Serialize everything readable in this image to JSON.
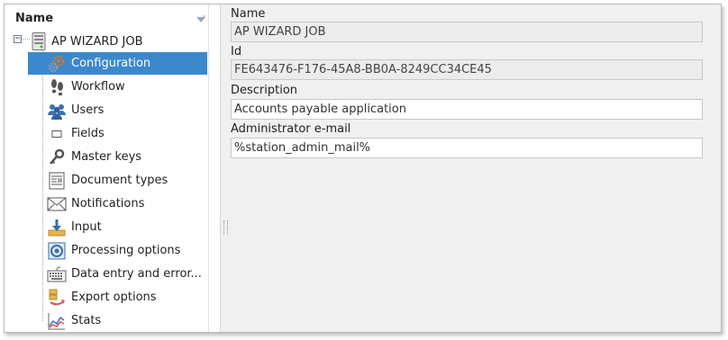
{
  "tree": {
    "header": "Name",
    "root": {
      "label": "AP WIZARD JOB"
    },
    "items": [
      {
        "label": "Configuration",
        "icon": "gears-icon"
      },
      {
        "label": "Workflow",
        "icon": "footprints-icon"
      },
      {
        "label": "Users",
        "icon": "users-icon"
      },
      {
        "label": "Fields",
        "icon": "field-box-icon"
      },
      {
        "label": "Master keys",
        "icon": "key-icon"
      },
      {
        "label": "Document types",
        "icon": "document-types-icon"
      },
      {
        "label": "Notifications",
        "icon": "envelope-icon"
      },
      {
        "label": "Input",
        "icon": "input-tray-icon"
      },
      {
        "label": "Processing options",
        "icon": "processing-icon"
      },
      {
        "label": "Data entry and error...",
        "icon": "keyboard-icon"
      },
      {
        "label": "Export options",
        "icon": "export-icon"
      },
      {
        "label": "Stats",
        "icon": "stats-chart-icon"
      }
    ],
    "selected_index": 0
  },
  "form": {
    "name_label": "Name",
    "name_value": "AP WIZARD JOB",
    "id_label": "Id",
    "id_value": "FE643476-F176-45A8-BB0A-8249CC34CE45",
    "description_label": "Description",
    "description_value": "Accounts payable application",
    "admin_email_label": "Administrator e-mail",
    "admin_email_value": "%station_admin_mail%"
  },
  "colors": {
    "selection": "#3d88cc",
    "readonly_field": "#ececec",
    "panel_bg": "#f0f0f0"
  }
}
